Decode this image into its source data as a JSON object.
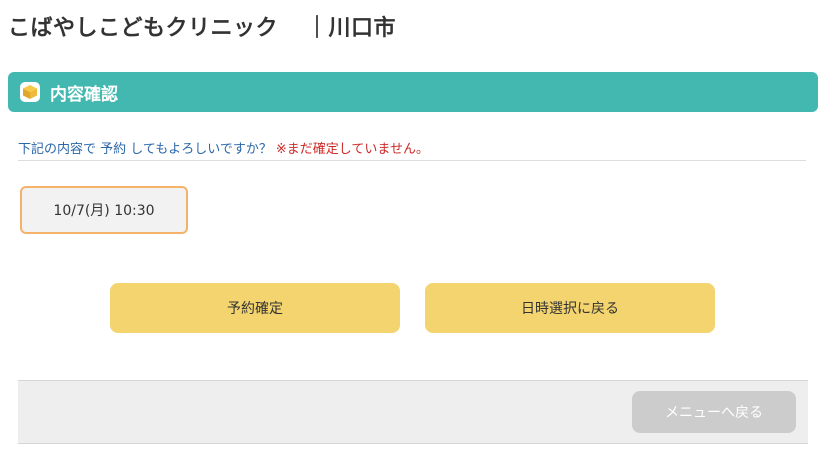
{
  "header": {
    "clinic_name": "こばやしこどもクリニック",
    "city": "｜川口市"
  },
  "section": {
    "title": "内容確認",
    "icon": "box-icon"
  },
  "confirm": {
    "question": "下記の内容で 予約 してもよろしいですか？",
    "warning": "※まだ確定していません。"
  },
  "reservation": {
    "datetime": "10/7(月) 10:30"
  },
  "buttons": {
    "confirm_label": "予約確定",
    "back_to_date_label": "日時選択に戻る",
    "back_to_menu_label": "メニューへ戻る"
  },
  "colors": {
    "header_bar": "#43b8b0",
    "primary_button": "#f3d46e",
    "disabled_button": "#cccccc",
    "highlight_border": "#f4b26a",
    "warning_text": "#cc2a2a",
    "question_text": "#2a67a8"
  }
}
